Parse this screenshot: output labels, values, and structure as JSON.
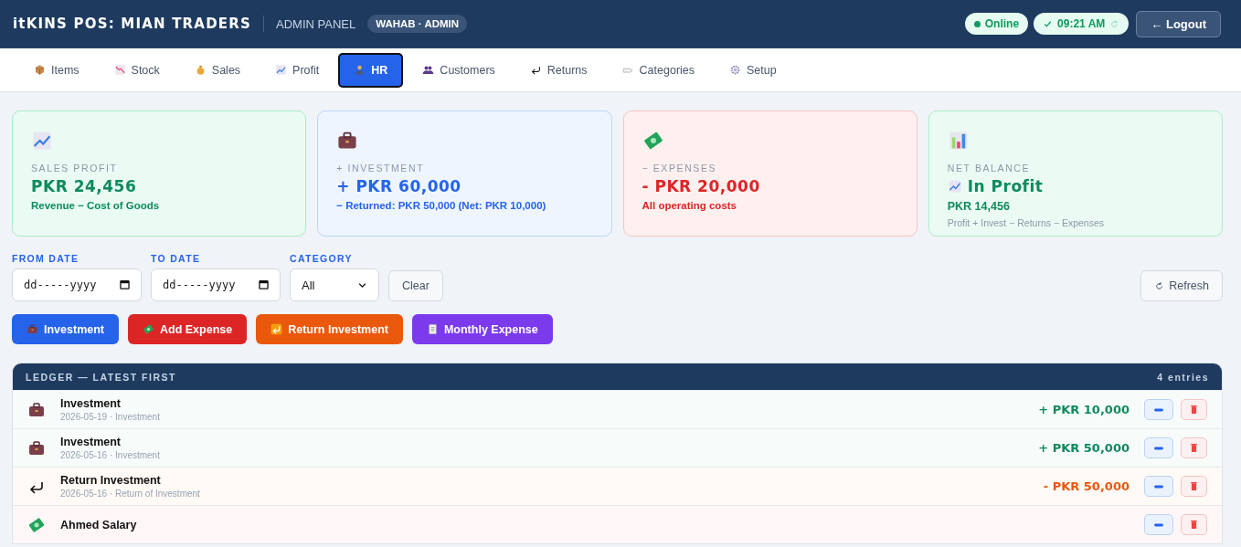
{
  "header": {
    "title": "itKINS POS: MIAN TRADERS",
    "panel_label": "ADMIN PANEL",
    "user_badge": "WAHAB · ADMIN",
    "status": "Online",
    "time": "09:21 AM",
    "logout": "← Logout"
  },
  "tabs": [
    {
      "label": "Items",
      "selected": false
    },
    {
      "label": "Stock",
      "selected": false
    },
    {
      "label": "Sales",
      "selected": false
    },
    {
      "label": "Profit",
      "selected": false
    },
    {
      "label": "HR",
      "selected": true
    },
    {
      "label": "Customers",
      "selected": false
    },
    {
      "label": "Returns",
      "selected": false
    },
    {
      "label": "Categories",
      "selected": false
    },
    {
      "label": "Setup",
      "selected": false
    }
  ],
  "cards": [
    {
      "kind": "profit",
      "label": "SALES PROFIT",
      "value": "PKR 24,456",
      "note": "Revenue − Cost of Goods"
    },
    {
      "kind": "investment",
      "label": "+ INVESTMENT",
      "value": "+ PKR 60,000",
      "note": "− Returned: PKR 50,000 (Net: PKR 10,000)"
    },
    {
      "kind": "expense",
      "label": "− EXPENSES",
      "value": "- PKR 20,000",
      "note": "All operating costs"
    },
    {
      "kind": "balance",
      "label": "NET BALANCE",
      "value": "In Profit",
      "amount": "PKR 14,456",
      "note": "Profit + Invest − Returns − Expenses"
    }
  ],
  "filters": {
    "from_date": {
      "label": "FROM DATE",
      "placeholder": "dd-----yyyy"
    },
    "to_date": {
      "label": "TO DATE",
      "placeholder": "dd-----yyyy"
    },
    "category": {
      "label": "CATEGORY",
      "value": "All"
    },
    "clear": "Clear",
    "refresh": "Refresh"
  },
  "actions": [
    {
      "kind": "investment",
      "label": "Investment"
    },
    {
      "kind": "expense",
      "label": "Add Expense"
    },
    {
      "kind": "return",
      "label": "Return Investment"
    },
    {
      "kind": "monthly",
      "label": "Monthly Expense"
    }
  ],
  "ledger": {
    "title": "LEDGER — LATEST FIRST",
    "count": "4 entries",
    "entries": [
      {
        "kind": "investment",
        "title": "Investment",
        "meta": "2026-05-19 · Investment",
        "amount": "+ PKR 10,000"
      },
      {
        "kind": "investment",
        "title": "Investment",
        "meta": "2026-05-16 · Investment",
        "amount": "+ PKR 50,000"
      },
      {
        "kind": "return",
        "title": "Return Investment",
        "meta": "2026-05-16 · Return of Investment",
        "amount": "- PKR 50,000"
      },
      {
        "kind": "expense",
        "title": "Ahmed Salary"
      }
    ]
  }
}
